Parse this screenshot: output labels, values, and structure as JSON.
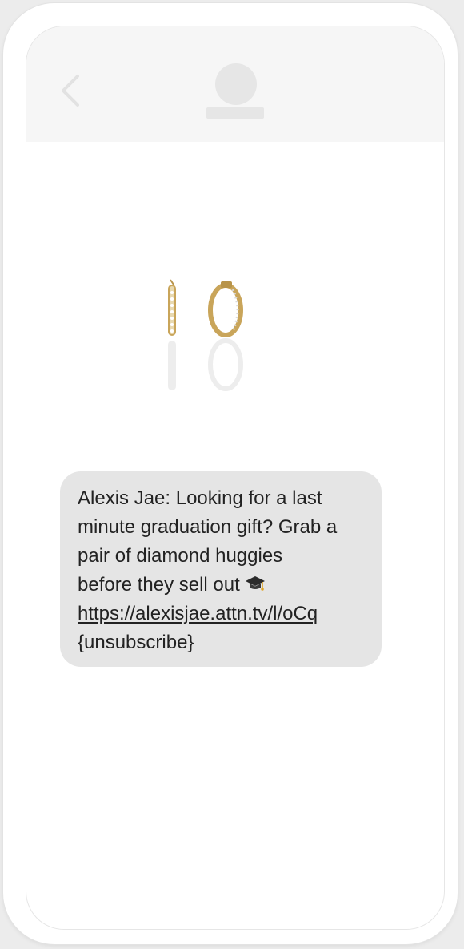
{
  "header": {
    "back_icon": "chevron-left-icon",
    "avatar_icon": "contact-avatar-icon"
  },
  "product_image": {
    "icon": "diamond-huggie-earrings-image"
  },
  "message": {
    "lines": [
      "Alexis Jae: Looking for a last",
      "minute graduation gift? Grab a",
      "pair of diamond huggies",
      "before they sell out"
    ],
    "emoji": "graduation-cap-icon",
    "link": "https://alexisjae.attn.tv/l/oCq",
    "footer": "{unsubscribe}"
  },
  "colors": {
    "bubble": "#e5e5e5",
    "header": "#f6f6f6",
    "text": "#222222",
    "gold": "#c9a55a"
  }
}
